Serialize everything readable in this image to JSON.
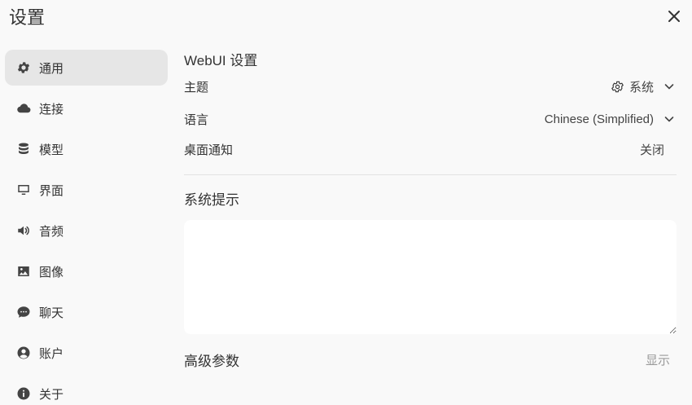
{
  "window": {
    "title": "设置"
  },
  "sidebar": {
    "items": [
      {
        "label": "通用",
        "icon": "gear-icon",
        "active": true
      },
      {
        "label": "连接",
        "icon": "cloud-icon"
      },
      {
        "label": "模型",
        "icon": "database-icon"
      },
      {
        "label": "界面",
        "icon": "monitor-icon"
      },
      {
        "label": "音频",
        "icon": "speaker-icon"
      },
      {
        "label": "图像",
        "icon": "image-icon"
      },
      {
        "label": "聊天",
        "icon": "chat-icon"
      },
      {
        "label": "账户",
        "icon": "user-icon"
      },
      {
        "label": "关于",
        "icon": "info-icon"
      }
    ]
  },
  "webui": {
    "heading": "WebUI 设置",
    "theme_label": "主题",
    "theme_value": "系统",
    "language_label": "语言",
    "language_value": "Chinese (Simplified)",
    "notify_label": "桌面通知",
    "notify_value": "关闭"
  },
  "system_prompt": {
    "heading": "系统提示",
    "value": ""
  },
  "advanced": {
    "heading": "高级参数",
    "toggle_label": "显示"
  }
}
